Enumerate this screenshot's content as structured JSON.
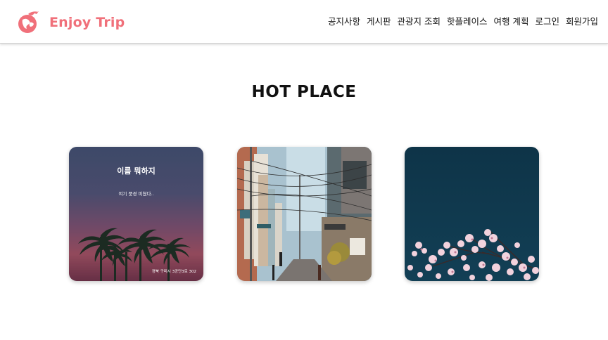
{
  "header": {
    "brand_name": "Enjoy Trip",
    "logo_icon": "bird-globe-logo-icon",
    "nav": [
      {
        "label": "공지사항"
      },
      {
        "label": "게시판"
      },
      {
        "label": "관광지 조회"
      },
      {
        "label": "핫플레이스"
      },
      {
        "label": "여행 계획"
      },
      {
        "label": "로그인"
      },
      {
        "label": "회원가입"
      }
    ]
  },
  "main": {
    "title": "HOT PLACE",
    "cards": [
      {
        "image": "palm-trees-sunset-photo",
        "title": "이름 뭐하지",
        "description": "여기 풍경 미쳤다..",
        "address": "경북 구미시 3공단3로 302"
      },
      {
        "image": "city-street-alley-photo",
        "title": "",
        "description": "",
        "address": ""
      },
      {
        "image": "cherry-blossom-night-photo",
        "title": "",
        "description": "",
        "address": ""
      }
    ]
  },
  "colors": {
    "brand": "#f0707a",
    "nav_text": "#111111"
  }
}
